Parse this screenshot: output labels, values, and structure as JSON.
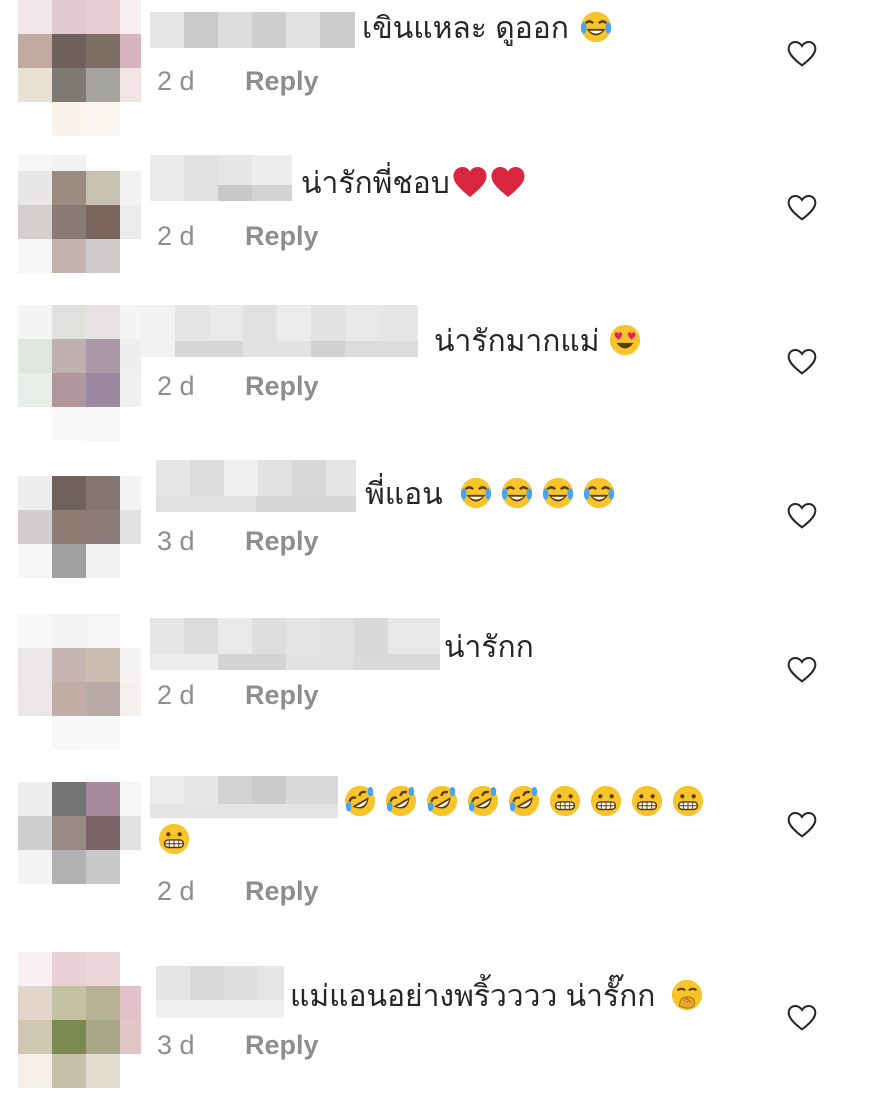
{
  "comments": [
    {
      "text": "เขินแหละ ดูออก",
      "emojis": [
        "joy"
      ],
      "time": "2 d",
      "reply": "Reply"
    },
    {
      "text": "น่ารักพี่ชอบ",
      "emojis": [
        "red-heart",
        "red-heart"
      ],
      "time": "2 d",
      "reply": "Reply"
    },
    {
      "text": "น่ารักมากแม่",
      "emojis": [
        "heart-eyes"
      ],
      "time": "2 d",
      "reply": "Reply"
    },
    {
      "text": "พี่แอน",
      "emojis": [
        "joy",
        "joy",
        "joy",
        "joy"
      ],
      "time": "3 d",
      "reply": "Reply"
    },
    {
      "text": "น่ารักก",
      "emojis": [],
      "time": "2 d",
      "reply": "Reply"
    },
    {
      "text": "",
      "emojis": [
        "rofl",
        "rofl",
        "rofl",
        "rofl",
        "rofl",
        "grimacing",
        "grimacing",
        "grimacing",
        "grimacing",
        "grimacing"
      ],
      "time": "2 d",
      "reply": "Reply"
    },
    {
      "text": "แม่แอนอย่างพริ้วววว น่ารั๊กก",
      "emojis": [
        "hand-over-mouth"
      ],
      "time": "3 d",
      "reply": "Reply"
    }
  ],
  "icons": {
    "like": "heart-outline-icon"
  },
  "colors": {
    "meta": "#8e8e8e",
    "text": "#262626",
    "heart_emoji": "#d7263d",
    "emoji_face": "#f7c52b"
  }
}
